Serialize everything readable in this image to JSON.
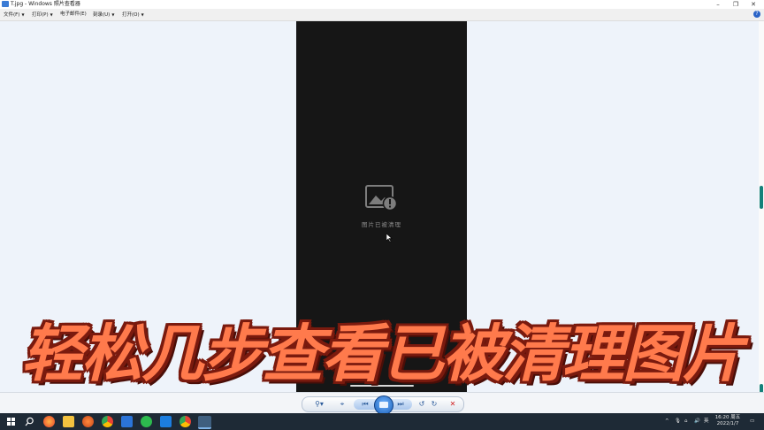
{
  "window": {
    "title": "T.jpg - Windows 照片查看器",
    "minimize_icon": "minimize-icon",
    "maximize_icon": "restore-icon",
    "close_icon": "close-icon"
  },
  "menu": {
    "items": [
      {
        "label": "文件(F)"
      },
      {
        "label": "打印(P)"
      },
      {
        "label": "电子邮件(E)"
      },
      {
        "label": "刻录(U)"
      },
      {
        "label": "打开(O)"
      }
    ],
    "help_label": "?"
  },
  "photo": {
    "placeholder_icon": "image-broken-icon",
    "placeholder_text": "图片已被清理"
  },
  "caption": {
    "text": "轻松几步查看已被清理图片"
  },
  "toolbar": {
    "zoom_icon": "zoom-icon",
    "actual_size_icon": "fit-window-icon",
    "previous_icon": "previous-icon",
    "slideshow_icon": "slideshow-icon",
    "next_icon": "next-icon",
    "rotate_left_icon": "rotate-ccw-icon",
    "rotate_right_icon": "rotate-cw-icon",
    "delete_icon": "delete-icon"
  },
  "taskbar": {
    "clock_time": "16:20 周五",
    "clock_date": "2022/1/7",
    "tray_lang": "英",
    "tray_chevron": "^"
  },
  "colors": {
    "accent": "#2a63c7",
    "caption_fill": "#ff7a4c",
    "caption_outline": "#7a1a0e",
    "photo_bg": "#161616",
    "viewer_bg": "#eef3fa",
    "taskbar_bg": "#1e2a36"
  }
}
